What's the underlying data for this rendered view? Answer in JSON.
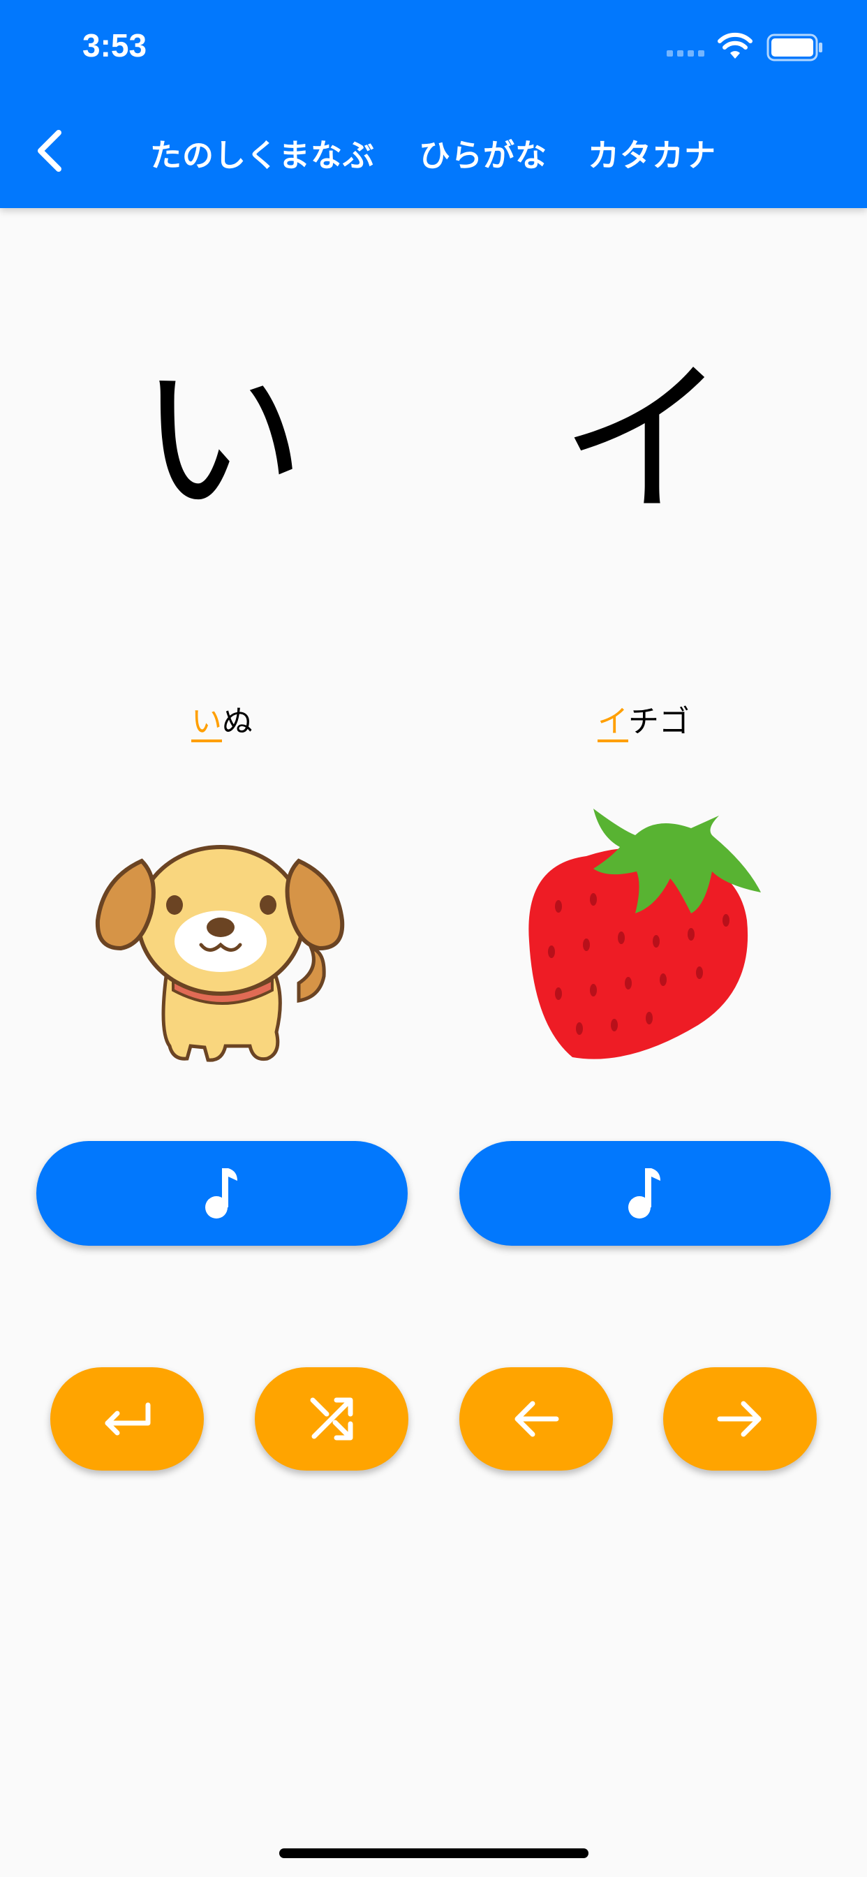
{
  "status_bar": {
    "time": "3:53"
  },
  "header": {
    "back_icon": "chevron-left-icon",
    "titles": [
      "たのしくまなぶ",
      "ひらがな",
      "カタカナ"
    ]
  },
  "letters": {
    "hiragana": "い",
    "katakana": "イ"
  },
  "words": {
    "left": {
      "highlight": "い",
      "rest": "ぬ",
      "image": "dog-illustration"
    },
    "right": {
      "highlight": "イ",
      "rest": "チゴ",
      "image": "strawberry-illustration"
    }
  },
  "sound_buttons": {
    "icon": "music-note-icon"
  },
  "controls": [
    {
      "icon": "return-icon"
    },
    {
      "icon": "shuffle-icon"
    },
    {
      "icon": "arrow-left-icon"
    },
    {
      "icon": "arrow-right-icon"
    }
  ],
  "colors": {
    "primary": "#0278fd",
    "accent": "#ffa400",
    "highlight_text": "#ff9f00",
    "background": "#fafafa"
  }
}
